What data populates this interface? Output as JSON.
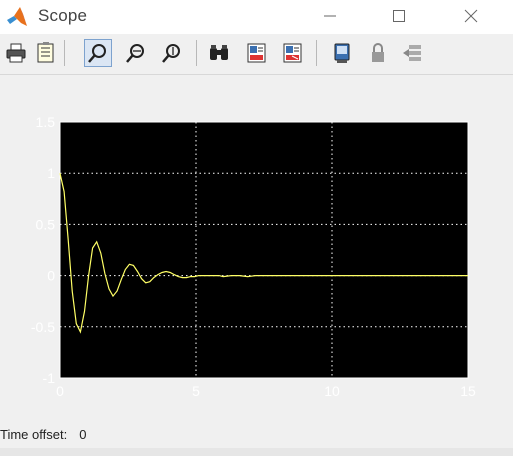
{
  "window": {
    "title": "Scope",
    "controls": [
      "minimize",
      "maximize",
      "close"
    ]
  },
  "toolbar": {
    "buttons": [
      {
        "name": "print-icon",
        "active": false
      },
      {
        "name": "parameters-icon",
        "active": false
      },
      {
        "name": "zoom-icon",
        "active": true
      },
      {
        "name": "zoom-x-icon",
        "active": false
      },
      {
        "name": "zoom-y-icon",
        "active": false
      },
      {
        "name": "autoscale-icon",
        "active": false
      },
      {
        "name": "save-axes-settings-icon",
        "active": false
      },
      {
        "name": "restore-axes-settings-icon",
        "active": false
      },
      {
        "name": "floating-scope-icon",
        "active": false
      },
      {
        "name": "lock-axes-icon",
        "active": false
      },
      {
        "name": "signal-selection-icon",
        "active": false
      }
    ]
  },
  "status": {
    "time_offset_label": "Time offset:",
    "time_offset_value": "0"
  },
  "chart_data": {
    "type": "line",
    "title": "",
    "xlabel": "",
    "ylabel": "",
    "xlim": [
      0,
      15
    ],
    "ylim": [
      -1,
      1.5
    ],
    "x_ticks": [
      "0",
      "5",
      "10",
      "15"
    ],
    "y_ticks": [
      "1.5",
      "1",
      "0.5",
      "0",
      "-0.5",
      "-1"
    ],
    "grid": true,
    "background": "#000000",
    "line_color": "#ffff66",
    "grid_color": "#ffffff",
    "series": [
      {
        "x": [
          0,
          0.15,
          0.3,
          0.45,
          0.6,
          0.75,
          0.9,
          1.05,
          1.2,
          1.35,
          1.5,
          1.65,
          1.8,
          1.95,
          2.1,
          2.25,
          2.4,
          2.55,
          2.7,
          2.85,
          3.0,
          3.15,
          3.3,
          3.45,
          3.6,
          3.75,
          3.9,
          4.05,
          4.2,
          4.35,
          4.5,
          4.65,
          4.8,
          4.95,
          5.1,
          5.25,
          5.4,
          5.55,
          5.7,
          5.85,
          6.0,
          6.3,
          6.6,
          6.9,
          7.2,
          7.5,
          8,
          9,
          10,
          11,
          12,
          13,
          14,
          15
        ],
        "y": [
          1.0,
          0.82,
          0.35,
          -0.15,
          -0.47,
          -0.55,
          -0.35,
          0.0,
          0.27,
          0.33,
          0.22,
          0.02,
          -0.13,
          -0.2,
          -0.15,
          -0.04,
          0.06,
          0.11,
          0.1,
          0.04,
          -0.03,
          -0.07,
          -0.06,
          -0.02,
          0.01,
          0.03,
          0.04,
          0.03,
          0.01,
          -0.01,
          -0.02,
          -0.02,
          -0.01,
          -0.01,
          0.0,
          0.0,
          0.0,
          0.0,
          0.0,
          0.0,
          -0.01,
          0.0,
          0.0,
          -0.01,
          0.0,
          0.0,
          0.0,
          0.0,
          0.0,
          0.0,
          0.0,
          0.0,
          0.0,
          0.0
        ]
      }
    ]
  }
}
